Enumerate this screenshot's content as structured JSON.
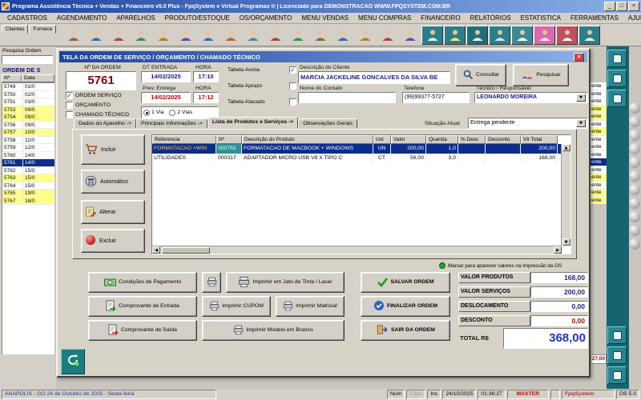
{
  "colors": {
    "title1": "#1c44a0",
    "title2": "#8ab0e8",
    "sel": "#0c2e8a",
    "yellow": "#ffff8a",
    "blueval": "#1a1aa0",
    "red": "#cc0000",
    "maroon": "#8b0000",
    "total": "#2233cc",
    "teal": "#156570"
  },
  "titlebar": {
    "title": "Programa Assistência Técnica + Vendas + Financeiro v5.0 Plus - FpqSystem e Virtual Programas ® | Licenciado para DEMONSTRACAO WWW.FPQSYSTEM.COM.BR"
  },
  "menubar": {
    "items": [
      "CADASTROS",
      "AGENDAMENTO",
      "APARELHOS",
      "PRODUTO/ESTOQUE",
      "OS/ORÇAMENTO",
      "MENU VENDAS",
      "MENU COMPRAS",
      "FINANCEIRO",
      "RELATÓRIOS",
      "ESTATISTICA",
      "FERRAMENTAS",
      "AJUDA"
    ]
  },
  "toolbar": {
    "tabs": [
      "Clientes",
      "Fornece"
    ],
    "icons": [
      {
        "b": "#8a6a3a"
      },
      {
        "b": "#3a6ea5"
      },
      {
        "b": "#a04848"
      },
      {
        "b": "#3a8a5a"
      },
      {
        "b": "#b08030"
      },
      {
        "b": "#6a4a9a"
      },
      {
        "b": "#3a6ea5"
      },
      {
        "b": "#c06030"
      },
      {
        "b": "#4a8a8a"
      },
      {
        "b": "#a04848"
      },
      {
        "b": "#3a8a5a"
      },
      {
        "b": "#8a6a3a"
      },
      {
        "b": "#3a6ea5"
      },
      {
        "b": "#b08030"
      },
      {
        "b": "#a04848"
      },
      {
        "b": "#6a4a9a"
      },
      {
        "b": "#e8f0f4",
        "bg": "#2a7f8a"
      },
      {
        "b": "#ffe080",
        "bg": "#2a7f8a"
      },
      {
        "b": "#e8f0f4",
        "bg": "#1f6f7a"
      },
      {
        "b": "#cfe8ff",
        "bg": "#2a7f8a"
      },
      {
        "b": "#ffffff",
        "bg": "#3a8a97"
      },
      {
        "b": "#ffe0f0",
        "bg": "#d86ab0"
      },
      {
        "b": "#ffffff",
        "bg": "#c05060"
      },
      {
        "b": "#e0ffe0",
        "bg": "#2a7f8a"
      }
    ]
  },
  "background": {
    "search_label": "Pesquisa Ordem",
    "list_title": "ORDEM DE S",
    "columns": [
      "Nº",
      "Data"
    ],
    "status_text": "ente",
    "bottom_total": "27,00",
    "rows": [
      {
        "n": "5749",
        "d": "01/0"
      },
      {
        "n": "5750",
        "d": "02/0"
      },
      {
        "n": "5751",
        "d": "03/0"
      },
      {
        "n": "5753",
        "d": "09/0",
        "y": true
      },
      {
        "n": "5754",
        "d": "09/0",
        "y": true
      },
      {
        "n": "5756",
        "d": "09/0"
      },
      {
        "n": "5757",
        "d": "10/0",
        "y": true
      },
      {
        "n": "5758",
        "d": "11/0"
      },
      {
        "n": "5759",
        "d": "12/0"
      },
      {
        "n": "5760",
        "d": "14/0"
      },
      {
        "n": "5761",
        "d": "14/0",
        "sel": true
      },
      {
        "n": "5762",
        "d": "15/0"
      },
      {
        "n": "5763",
        "d": "15/0",
        "y": true
      },
      {
        "n": "5764",
        "d": "15/0"
      },
      {
        "n": "5765",
        "d": "19/0",
        "y": true
      },
      {
        "n": "5767",
        "d": "16/0",
        "y": true
      }
    ]
  },
  "dialog": {
    "title": "TELA DA ORDEM DE SERVIÇO / ORÇAMENTO / CHAMADO TÉCNICO",
    "order": {
      "number_label": "Nº DA ORDEM",
      "number": "5761",
      "types": [
        {
          "label": "ORDEM SERVIÇO",
          "checked": true
        },
        {
          "label": "ORÇAMENTO",
          "checked": false
        },
        {
          "label": "CHAMADO TÉCNICO",
          "checked": false
        }
      ],
      "dt_entrada_label": "DT ENTRADA",
      "hora_label": "HORA",
      "dt_entrada": "14/02/2025",
      "hora_entrada": "17:10",
      "prev_entrega_label": "Prev. Entrega",
      "prev_entrega": "14/02/2025",
      "hora_entrega": "17:12",
      "tabelas": [
        {
          "label": "Tabela Avista",
          "checked": true
        },
        {
          "label": "Tabela Aprazo",
          "checked": false
        },
        {
          "label": "Tabela Atacado",
          "checked": false
        }
      ],
      "vias": [
        {
          "label": "1 Via",
          "selected": true
        },
        {
          "label": "2 Vias",
          "selected": false
        }
      ]
    },
    "client": {
      "desc_label": "Descrição do Cliente",
      "name": "MARCIA JACKELINE GONCALVES DA SILVA BE",
      "contato_label": "Nome do Contato",
      "contato": "",
      "telefone_label": "Telefone",
      "telefone": "(99)99377-5727",
      "tecnico_label": "Técnico / Responsável",
      "tecnico": "LEONARDO MOREIRA",
      "consultar": "Consultar",
      "pesquisar": "Pesquisar"
    },
    "tabs": [
      "Dados do Aparelho ->",
      "Principais Informações ->",
      "Lista de Produtos e Serviços ->",
      "Observações Gerais"
    ],
    "active_tab": 2,
    "situacao_label": "Situação Atual:",
    "situacao": "Entrega pendente",
    "side_buttons": [
      "Incluir",
      "Automático",
      "Alterar",
      "Excluir"
    ],
    "products": {
      "columns": [
        "Referencia",
        "Nº",
        "Descrição do Produto",
        "Uni",
        "Valor",
        "Quantia",
        "% Desc",
        "Desconto",
        "Vlr Total"
      ],
      "rows": [
        {
          "ref": "FORMATACAO +WIN",
          "num": "000752",
          "desc": "FORMATACAO DE MACBOOK + WINDOWS",
          "uni": "UN",
          "valor": "200,00",
          "qtd": "1,0",
          "pdesc": "",
          "desconto": "",
          "total": "200,00",
          "selected": true
        },
        {
          "ref": "UTILIDADES",
          "num": "000317",
          "desc": "ADAPTADOR MICRO USB V8 X TIPO C",
          "uni": "CT",
          "valor": "56,00",
          "qtd": "3,0",
          "pdesc": "",
          "desconto": "",
          "total": "168,00"
        }
      ]
    },
    "print_radio": "Marcar para aparecer valores na Impressão da OS",
    "buttons": {
      "pagamento": "Condições de Pagamento",
      "entrada": "Comprovante de Entrada",
      "saida": "Comprovante de Saída",
      "jato": "Imprimir em Jato de Tinta / Laser",
      "cupom": "Imprimir CUPOM",
      "matricial": "Imprimir Matricial",
      "branco": "Imprimir Modelo em Branco",
      "salvar": "SALVAR ORDEM",
      "finalizar": "FINALIZAR ORDEM",
      "sair": "SAIR DA ORDEM"
    },
    "totals": [
      {
        "label": "VALOR PRODUTOS",
        "value": "168,00"
      },
      {
        "label": "VALOR SERVIÇOS",
        "value": "200,00"
      },
      {
        "label": "DESLOCAMENTO",
        "value": "0,00"
      },
      {
        "label": "DESCONTO",
        "value": "0,00",
        "red": true
      }
    ],
    "total_label": "TOTAL R$",
    "total_value": "368,00"
  },
  "statusbar": {
    "location": "ANAPOLIS - GO 24 de Outubro de 2025 - Sexta-feira",
    "num": "Num",
    "caps": "Caps",
    "ins": "Ins",
    "date": "24/10/2025",
    "time": "01:36:27",
    "user": "MASTER",
    "brand": "FpqSystem",
    "version": "OS 5.0"
  }
}
